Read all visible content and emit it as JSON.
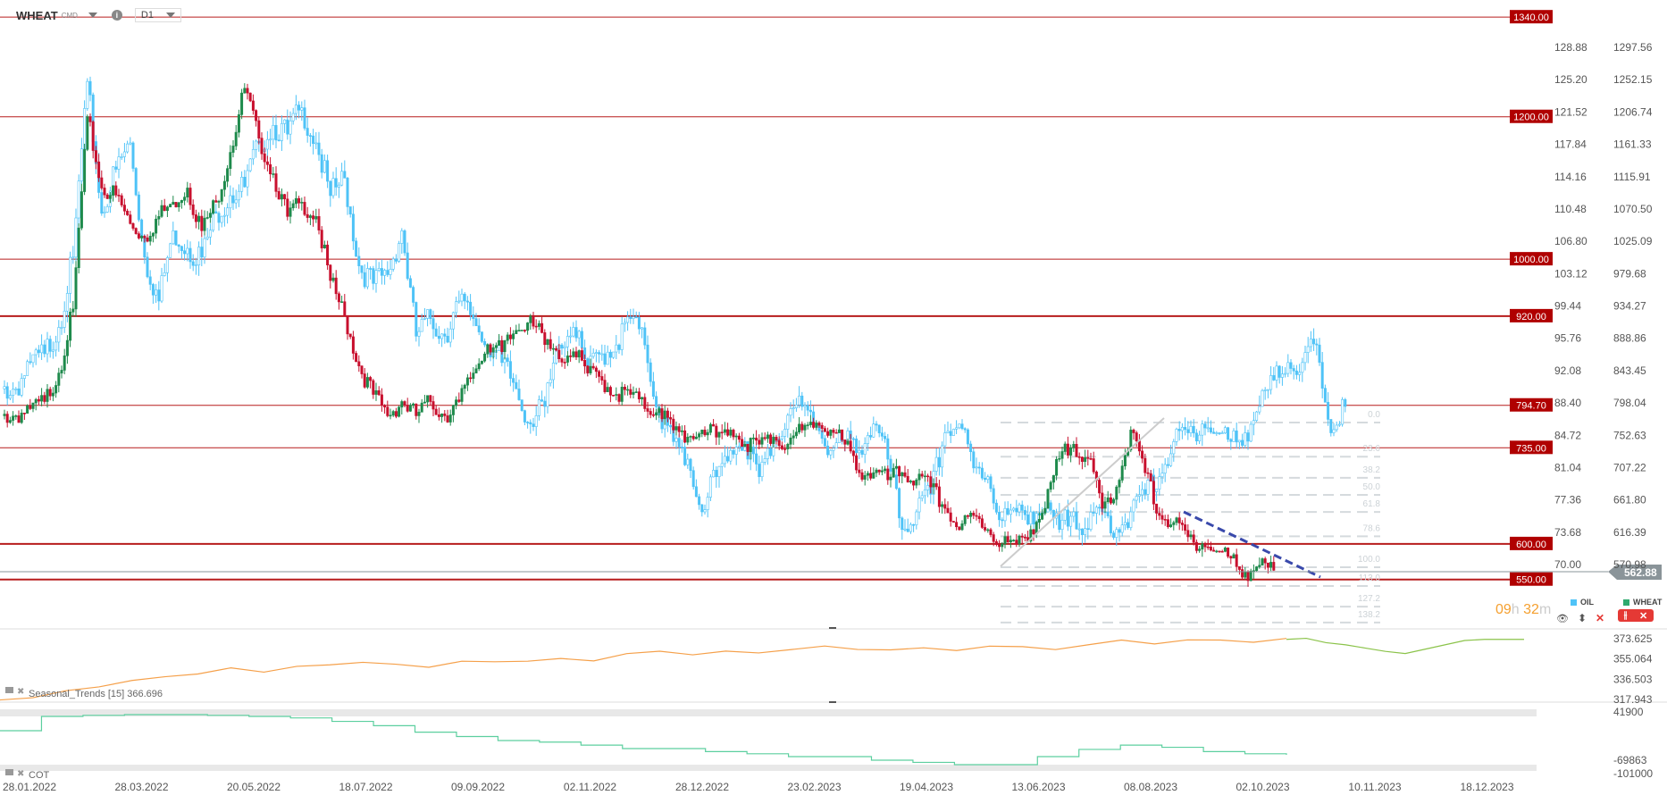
{
  "header": {
    "symbol": "WHEAT",
    "type": "CMD",
    "info": "i",
    "timeframe": "D1"
  },
  "timer": {
    "hours": "09",
    "h": "h",
    "minutes": "32",
    "m": "m"
  },
  "legend": {
    "oil": "OIL",
    "wheat": "WHEAT",
    "oil_color": "#4fc3f7",
    "wheat_color": "#2eaa6e"
  },
  "controls": {
    "eye": "👁",
    "updown": "⬍",
    "close": "✕",
    "candle": "⫲",
    "remove": "✕"
  },
  "panels": {
    "seasonal_label": "Seasonal_Trends [15] 366.696",
    "cot_label": "COT"
  },
  "current_price": "562.88",
  "chart_data": {
    "type": "candlestick",
    "title": "WHEAT vs OIL D1",
    "x_tick_labels": [
      "28.01.2022",
      "28.03.2022",
      "20.05.2022",
      "18.07.2022",
      "09.09.2022",
      "02.11.2022",
      "28.12.2022",
      "23.02.2023",
      "19.04.2023",
      "13.06.2023",
      "08.08.2023",
      "02.10.2023",
      "10.11.2023",
      "18.12.2023"
    ],
    "wheat_axis": [
      "1297.56",
      "1252.15",
      "1206.74",
      "1161.33",
      "1115.91",
      "1070.50",
      "1025.09",
      "979.68",
      "934.27",
      "888.86",
      "843.45",
      "798.04",
      "752.63",
      "707.22",
      "661.80",
      "616.39",
      "570.98"
    ],
    "oil_axis": [
      "128.88",
      "125.20",
      "121.52",
      "117.84",
      "114.16",
      "110.48",
      "106.80",
      "103.12",
      "99.44",
      "95.76",
      "92.08",
      "88.40",
      "84.72",
      "81.04",
      "77.36",
      "73.68",
      "70.00"
    ],
    "levels": [
      {
        "value": 1340,
        "label": "1340.00",
        "bold": false
      },
      {
        "value": 1200,
        "label": "1200.00",
        "bold": false
      },
      {
        "value": 1000,
        "label": "1000.00",
        "bold": false
      },
      {
        "value": 920,
        "label": "920.00",
        "bold": true
      },
      {
        "value": 794.7,
        "label": "794.70",
        "bold": false
      },
      {
        "value": 735,
        "label": "735.00",
        "bold": false
      },
      {
        "value": 600,
        "label": "600.00",
        "bold": true
      },
      {
        "value": 550,
        "label": "550.00",
        "bold": true
      }
    ],
    "fibonacci": [
      "0.0",
      "23.6",
      "38.2",
      "50.0",
      "61.8",
      "78.6",
      "100.0",
      "113.0",
      "127.2",
      "138.2"
    ],
    "wheat_weekly_close": [
      780,
      790,
      800,
      840,
      930,
      1200,
      1100,
      1090,
      1050,
      1030,
      1060,
      1080,
      1100,
      1040,
      1080,
      1150,
      1240,
      1170,
      1120,
      1060,
      1080,
      1060,
      970,
      920,
      850,
      810,
      780,
      800,
      780,
      800,
      780,
      800,
      840,
      880,
      870,
      900,
      920,
      880,
      860,
      870,
      840,
      830,
      810,
      810,
      790,
      790,
      760,
      750,
      760,
      750,
      760,
      740,
      740,
      750,
      740,
      760,
      770,
      760,
      740,
      700,
      700,
      690,
      700,
      690,
      680,
      650,
      620,
      640,
      620,
      600,
      600,
      620,
      650,
      720,
      740,
      720,
      650,
      680,
      760,
      700,
      640,
      630,
      610,
      600,
      590,
      580,
      560,
      570,
      563
    ],
    "oil_weekly_close": [
      90,
      93,
      94,
      97,
      105,
      125,
      110,
      115,
      118,
      105,
      100,
      108,
      106,
      105,
      110,
      112,
      113,
      118,
      120,
      119,
      122,
      118,
      112,
      114,
      104,
      102,
      103,
      108,
      96,
      98,
      96,
      100,
      98,
      95,
      93,
      90,
      86,
      88,
      95,
      97,
      92,
      94,
      95,
      98,
      95,
      87,
      84,
      82,
      76,
      80,
      83,
      84,
      80,
      84,
      87,
      88,
      86,
      83,
      84,
      83,
      86,
      82,
      74,
      76,
      78,
      85,
      86,
      81,
      80,
      75,
      76,
      76,
      76,
      74,
      76,
      74,
      76,
      74,
      76,
      78,
      80,
      84,
      85,
      86,
      85,
      84,
      85,
      88,
      91,
      93,
      93,
      95,
      85,
      88
    ],
    "seasonal": {
      "label": "Seasonal_Trends",
      "period": 15,
      "value": "366.696",
      "axis": [
        "373.625",
        "355.064",
        "336.503",
        "317.943"
      ],
      "history": [
        318,
        322,
        326,
        330,
        334,
        336,
        340,
        345,
        342,
        346,
        348,
        350,
        352,
        350,
        355,
        354,
        356,
        358,
        355,
        357,
        360,
        358,
        361,
        360,
        362,
        364,
        361,
        365,
        366,
        364,
        367,
        368,
        366,
        369,
        370,
        368,
        371,
        372,
        370,
        373
      ],
      "forecast": [
        373,
        374,
        370,
        368,
        365,
        362,
        360,
        364,
        368,
        372,
        373,
        373,
        373
      ]
    },
    "cot": {
      "label": "COT",
      "axis": [
        "41900",
        "-69863",
        "-101000"
      ],
      "values": [
        -1590,
        31500,
        34000,
        35700,
        35700,
        34000,
        31500,
        28000,
        20000,
        10000,
        -5000,
        -15000,
        -24400,
        -28000,
        -35000,
        -43000,
        -43000,
        -50000,
        -55000,
        -61700,
        -61700,
        -70000,
        -75000,
        -80300,
        -80300,
        -61700,
        -45000,
        -35000,
        -40000,
        -50000,
        -55000,
        -57500
      ]
    }
  }
}
